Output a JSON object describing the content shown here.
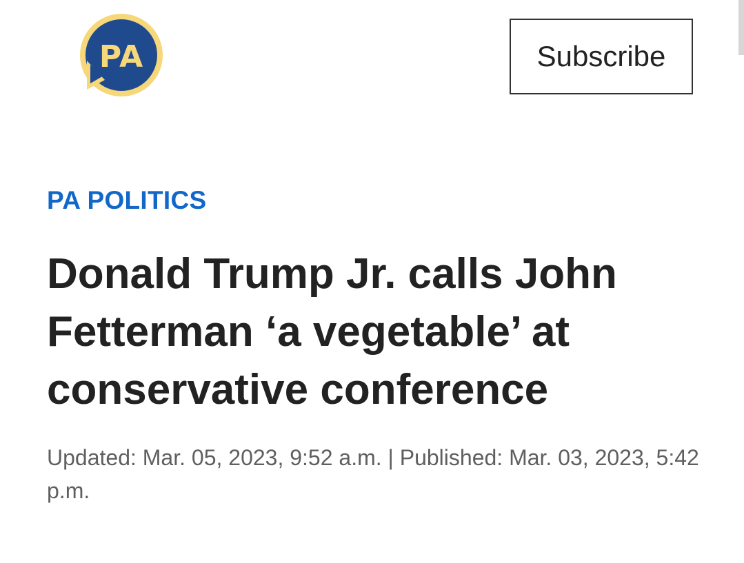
{
  "header": {
    "logo_text": "PA",
    "subscribe_label": "Subscribe"
  },
  "article": {
    "category": "PA POLITICS",
    "headline": "Donald Trump Jr. calls John Fetterman ‘a vegetable’ at conservative conference",
    "updated": "Updated: Mar. 05, 2023, 9:52 a.m.",
    "separator": " | ",
    "published": "Published: Mar. 03, 2023, 5:42 p.m."
  },
  "colors": {
    "logo_blue": "#1f4b8e",
    "logo_yellow": "#f6d77a",
    "category_blue": "#1168c8",
    "headline_text": "#222222",
    "dateline_text": "#5f5f5f"
  }
}
